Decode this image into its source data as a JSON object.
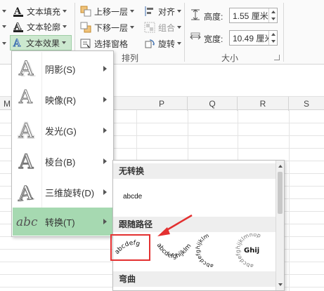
{
  "ribbon": {
    "left_group": {
      "text_fill": "文本填充",
      "text_outline": "文本轮廓",
      "text_effects": "文本效果"
    },
    "arrange_group": {
      "bring_forward": "上移一层",
      "send_backward": "下移一层",
      "selection_pane": "选择窗格",
      "align": "对齐",
      "group": "组合",
      "rotate": "旋转",
      "label": "排列"
    },
    "size_group": {
      "height_label": "高度:",
      "height_value": "1.55 厘米",
      "width_label": "宽度:",
      "width_value": "10.49 厘米",
      "label": "大小"
    }
  },
  "sheet": {
    "columns": [
      "M",
      "",
      "",
      "",
      "P",
      "Q",
      "R",
      "S"
    ]
  },
  "text_effects_menu": {
    "items": [
      {
        "label": "阴影(S)",
        "icon": "shadow-a-icon"
      },
      {
        "label": "映像(R)",
        "icon": "reflection-a-icon"
      },
      {
        "label": "发光(G)",
        "icon": "glow-a-icon"
      },
      {
        "label": "棱台(B)",
        "icon": "bevel-a-icon"
      },
      {
        "label": "三维旋转(D)",
        "icon": "rotation-3d-a-icon"
      },
      {
        "label": "转换(T)",
        "icon": "transform-abc-icon",
        "active": true
      }
    ],
    "transform_icon_text": "abc"
  },
  "transform_gallery": {
    "section_no_transform": "无转换",
    "plain_sample": "abcde",
    "section_follow_path": "跟随路径",
    "path_samples": [
      "abcdefg",
      "abcdefghijklm",
      "abcdefghijklm",
      "Ghij"
    ],
    "section_warp": "弯曲"
  },
  "colors": {
    "accent_green": "#a6d9b1",
    "highlight_red": "#e33030",
    "ribbon_bg": "#fafafa"
  }
}
